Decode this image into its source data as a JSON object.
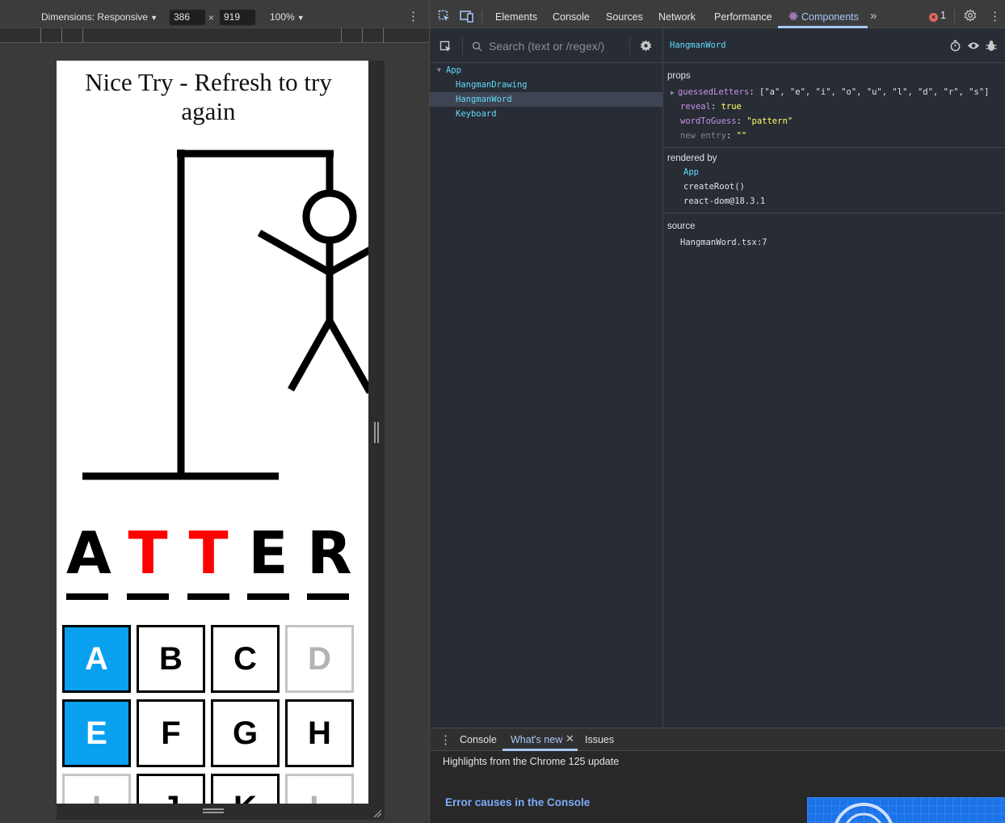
{
  "device_toolbar": {
    "dimensions_label": "Dimensions: Responsive",
    "width_value": "386",
    "times": "×",
    "height_value": "919",
    "zoom": "100%"
  },
  "page": {
    "title": "Nice Try - Refresh to try again",
    "word": [
      {
        "char": "A",
        "color": "#000000"
      },
      {
        "char": "T",
        "color": "#ff0000"
      },
      {
        "char": "T",
        "color": "#ff0000"
      },
      {
        "char": "E",
        "color": "#000000"
      },
      {
        "char": "R",
        "color": "#000000"
      }
    ],
    "keys": [
      {
        "label": "A",
        "state": "active"
      },
      {
        "label": "B",
        "state": "normal"
      },
      {
        "label": "C",
        "state": "normal"
      },
      {
        "label": "D",
        "state": "inactive"
      },
      {
        "label": "E",
        "state": "active"
      },
      {
        "label": "F",
        "state": "normal"
      },
      {
        "label": "G",
        "state": "normal"
      },
      {
        "label": "H",
        "state": "normal"
      },
      {
        "label": "I",
        "state": "inactive"
      },
      {
        "label": "J",
        "state": "normal"
      },
      {
        "label": "K",
        "state": "normal"
      },
      {
        "label": "L",
        "state": "inactive"
      }
    ],
    "accent_color": "#0aa0f0"
  },
  "devtools": {
    "tabs": [
      "Elements",
      "Console",
      "Sources",
      "Network",
      "Performance",
      "Components"
    ],
    "selected_tab": "Components",
    "error_count": "1",
    "search_placeholder": "Search (text or /regex/)",
    "tree": [
      {
        "label": "App",
        "depth": 0,
        "expanded": true
      },
      {
        "label": "HangmanDrawing",
        "depth": 1
      },
      {
        "label": "HangmanWord",
        "depth": 1,
        "selected": true
      },
      {
        "label": "Keyboard",
        "depth": 1
      }
    ],
    "selected_component": "HangmanWord",
    "props_title": "props",
    "props": {
      "guessed_key": "guessedLetters",
      "guessed_value": "[\"a\", \"e\", \"i\", \"o\", \"u\", \"l\", \"d\", \"r\", \"s\"]",
      "reveal_key": "reveal",
      "reveal_value": "true",
      "word_key": "wordToGuess",
      "word_value": "\"pattern\"",
      "new_entry_key": "new entry",
      "new_entry_value": "\"\""
    },
    "rendered_by_title": "rendered by",
    "rendered_by": [
      "App",
      "createRoot()",
      "react-dom@18.3.1"
    ],
    "source_title": "source",
    "source_file": "HangmanWord.tsx:7"
  },
  "drawer": {
    "tabs": [
      "Console",
      "What's new",
      "Issues"
    ],
    "selected_tab": "What's new",
    "highlights": "Highlights from the Chrome 125 update",
    "feature_title": "Error causes in the Console"
  }
}
